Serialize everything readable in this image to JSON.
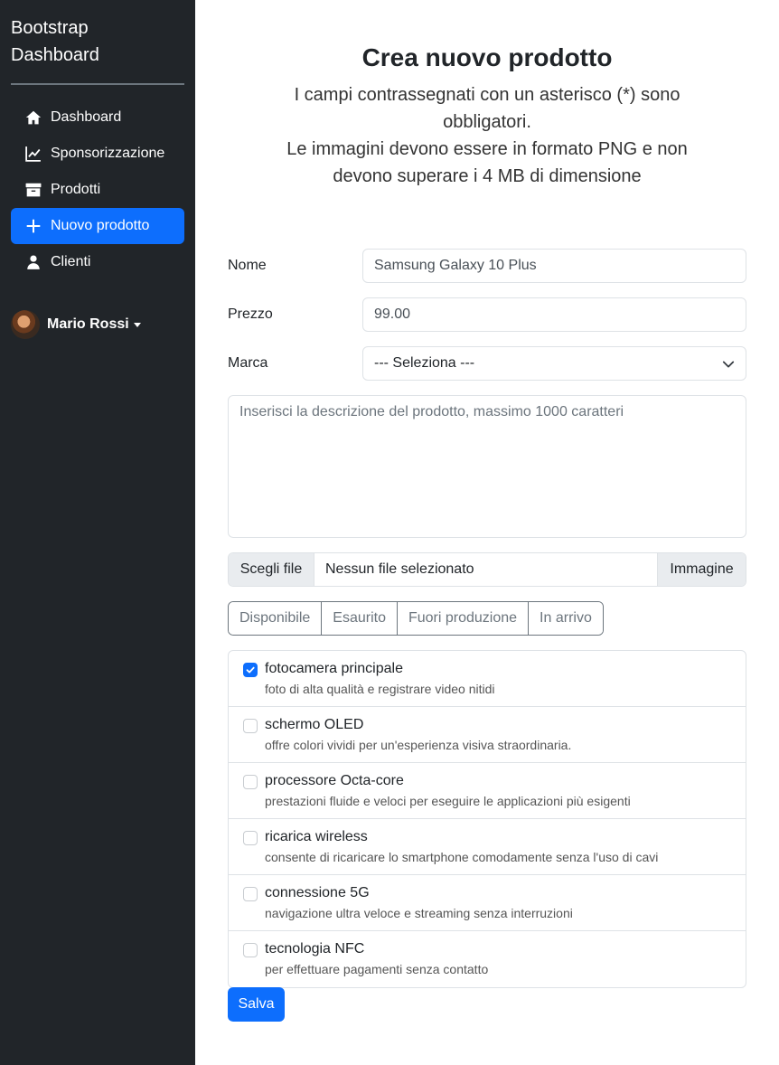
{
  "sidebar": {
    "brand_line1": "Bootstrap",
    "brand_line2": "Dashboard",
    "items": [
      {
        "label": "Dashboard",
        "icon": "home-icon"
      },
      {
        "label": "Sponsorizzazione",
        "icon": "chart-line-icon"
      },
      {
        "label": "Prodotti",
        "icon": "archive-box-icon"
      },
      {
        "label": "Nuovo prodotto",
        "icon": "plus-icon",
        "active": true
      },
      {
        "label": "Clienti",
        "icon": "user-icon"
      }
    ],
    "user_name": "Mario Rossi"
  },
  "header": {
    "title": "Crea nuovo prodotto",
    "subtitle_line1": "I campi contrassegnati con un asterisco (*) sono",
    "subtitle_line2": "obbligatori.",
    "subtitle_line3": "Le immagini devono essere in formato PNG e non",
    "subtitle_line4": "devono superare i 4 MB di dimensione"
  },
  "form": {
    "name_label": "Nome",
    "name_value": "Samsung Galaxy 10 Plus",
    "price_label": "Prezzo",
    "price_value": "99.00",
    "brand_label": "Marca",
    "brand_selected": "--- Seleziona ---",
    "description_placeholder": "Inserisci la descrizione del prodotto, massimo 1000 caratteri",
    "file_button": "Scegli file",
    "file_name": "Nessun file selezionato",
    "file_addon": "Immagine",
    "status_options": [
      "Disponibile",
      "Esaurito",
      "Fuori produzione",
      "In arrivo"
    ],
    "features": [
      {
        "title": "fotocamera principale",
        "desc": "foto di alta qualità e registrare video nitidi",
        "checked": true
      },
      {
        "title": "schermo OLED",
        "desc": "offre colori vividi per un'esperienza visiva straordinaria.",
        "checked": false
      },
      {
        "title": "processore Octa-core",
        "desc": "prestazioni fluide e veloci per eseguire le applicazioni più esigenti",
        "checked": false
      },
      {
        "title": "ricarica wireless",
        "desc": "consente di ricaricare lo smartphone comodamente senza l'uso di cavi",
        "checked": false
      },
      {
        "title": "connessione 5G",
        "desc": "navigazione ultra veloce e streaming senza interruzioni",
        "checked": false
      },
      {
        "title": "tecnologia NFC",
        "desc": "per effettuare pagamenti senza contatto",
        "checked": false
      }
    ],
    "save_label": "Salva"
  },
  "colors": {
    "sidebar_bg": "#212529",
    "primary": "#0d6efd",
    "border": "#dee2e6"
  }
}
